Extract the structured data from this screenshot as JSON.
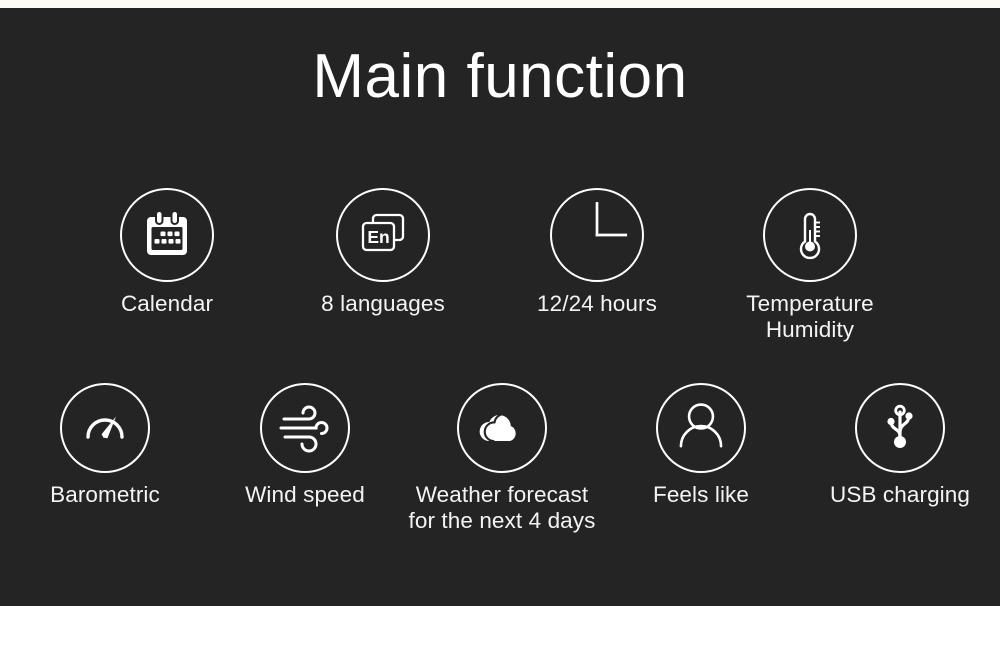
{
  "page": {
    "title": "Main function",
    "background_color": "#242424",
    "panel_color": "#242424",
    "top_band_color": "#fdfbf6",
    "text_color": "#f4f4f4",
    "accent_color": "#ffffff"
  },
  "features": {
    "row1": [
      {
        "label": "Calendar",
        "icon": "calendar-icon"
      },
      {
        "label": "8 languages",
        "icon": "language-en-icon"
      },
      {
        "label": "12/24 hours",
        "icon": "clock-icon"
      },
      {
        "label": "Temperature\nHumidity",
        "icon": "thermometer-icon"
      }
    ],
    "row2": [
      {
        "label": "Barometric",
        "icon": "gauge-icon"
      },
      {
        "label": "Wind speed",
        "icon": "wind-icon"
      },
      {
        "label": "Weather forecast\nfor the next 4 days",
        "icon": "cloud-icon"
      },
      {
        "label": "Feels like",
        "icon": "person-icon"
      },
      {
        "label": "USB charging",
        "icon": "usb-icon"
      }
    ]
  }
}
